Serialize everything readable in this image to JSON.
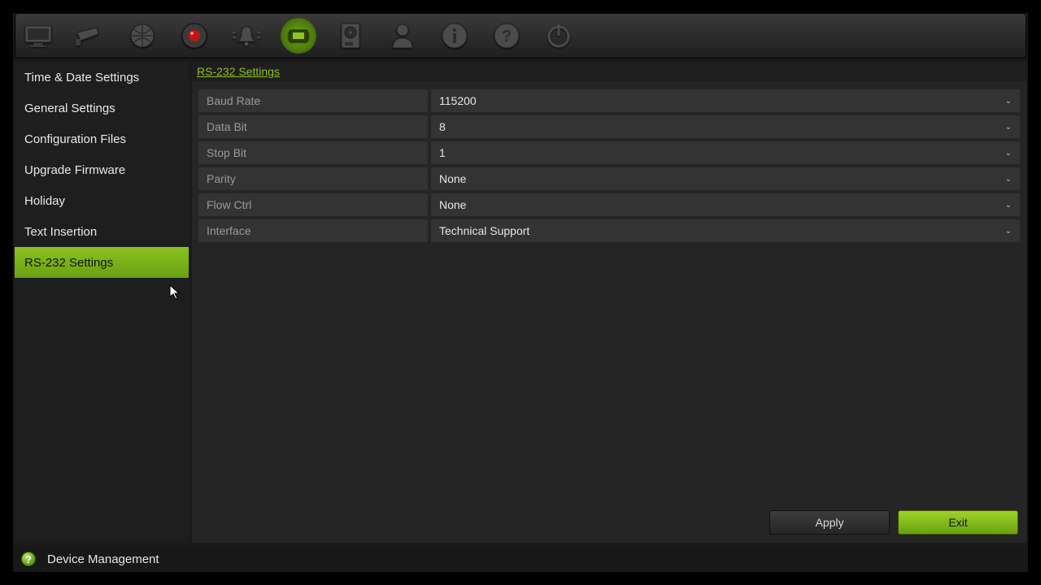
{
  "toolbar": {
    "icons": [
      {
        "name": "monitor-icon"
      },
      {
        "name": "camera-icon"
      },
      {
        "name": "network-icon"
      },
      {
        "name": "record-icon"
      },
      {
        "name": "alarm-icon"
      },
      {
        "name": "chip-icon",
        "active": true
      },
      {
        "name": "disk-icon"
      },
      {
        "name": "user-icon"
      },
      {
        "name": "info-icon"
      },
      {
        "name": "help-icon"
      },
      {
        "name": "power-icon"
      }
    ]
  },
  "sidebar": {
    "items": [
      {
        "label": "Time & Date Settings",
        "active": false
      },
      {
        "label": "General Settings",
        "active": false
      },
      {
        "label": "Configuration Files",
        "active": false
      },
      {
        "label": "Upgrade Firmware",
        "active": false
      },
      {
        "label": "Holiday",
        "active": false
      },
      {
        "label": "Text Insertion",
        "active": false
      },
      {
        "label": "RS-232 Settings",
        "active": true
      }
    ]
  },
  "main": {
    "title": "RS-232 Settings",
    "rows": [
      {
        "label": "Baud Rate",
        "value": "115200"
      },
      {
        "label": "Data Bit",
        "value": "8"
      },
      {
        "label": "Stop Bit",
        "value": "1"
      },
      {
        "label": "Parity",
        "value": "None"
      },
      {
        "label": "Flow Ctrl",
        "value": "None"
      },
      {
        "label": "Interface",
        "value": "Technical Support"
      }
    ],
    "buttons": {
      "apply": "Apply",
      "exit": "Exit"
    }
  },
  "footer": {
    "help_symbol": "?",
    "label": "Device Management"
  }
}
